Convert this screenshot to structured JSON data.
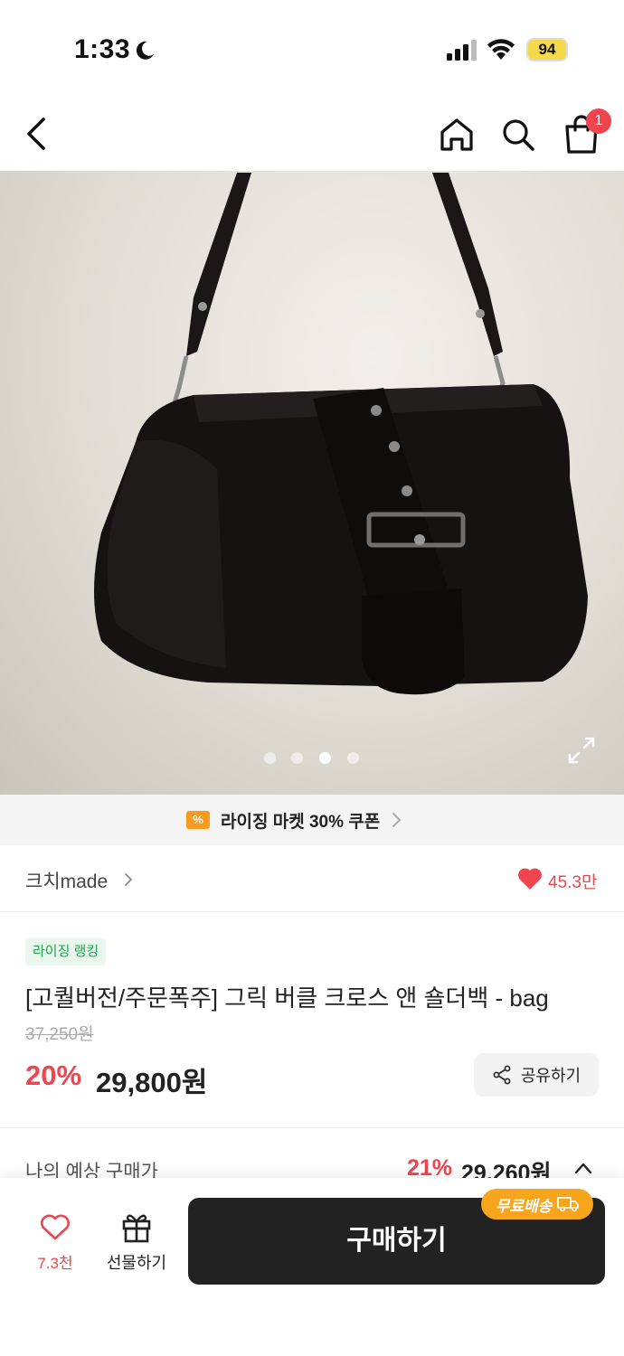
{
  "status_bar": {
    "time": "1:33",
    "battery": "94"
  },
  "header": {
    "cart_badge_count": "1"
  },
  "carousel": {
    "total_slides": 4,
    "active_index": 2
  },
  "coupon": {
    "icon_text": "%",
    "label": "라이징 마켓 30% 쿠폰"
  },
  "store": {
    "name": "크치made",
    "like_count": "45.3만"
  },
  "product": {
    "rank_badge": "라이징 랭킹",
    "title": "[고퀄버전/주문폭주] 그릭 버클 크로스 앤 숄더백 - bag",
    "original_price": "37,250원",
    "discount_rate": "20%",
    "sale_price": "29,800원",
    "share_label": "공유하기"
  },
  "expected": {
    "label": "나의 예상 구매가",
    "discount_rate": "21%",
    "price": "29,260원"
  },
  "bottom_bar": {
    "wish_count": "7.3천",
    "gift_label": "선물하기",
    "buy_label": "구매하기",
    "shipping_badge": "무료배송"
  },
  "colors": {
    "accent_red": "#f0444f",
    "buy_button": "#222222",
    "shipping_orange": "#f6a51d",
    "coupon_orange": "#f79a1e",
    "rank_green": "#1fa550"
  }
}
